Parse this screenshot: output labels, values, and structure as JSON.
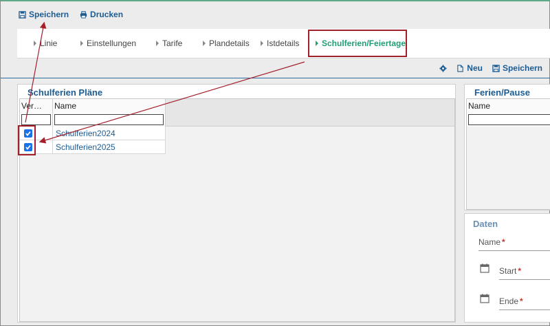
{
  "toolbar": {
    "save_label": "Speichern",
    "print_label": "Drucken"
  },
  "tabs": [
    {
      "label": "Linie",
      "active": false
    },
    {
      "label": "Einstellungen",
      "active": false
    },
    {
      "label": "Tarife",
      "active": false
    },
    {
      "label": "Plandetails",
      "active": false
    },
    {
      "label": "Istdetails",
      "active": false
    },
    {
      "label": "Schulferien/Feiertage",
      "active": true
    }
  ],
  "actions": {
    "settings_icon": "gear-icon",
    "new_label": "Neu",
    "save_label": "Speichern"
  },
  "left_panel": {
    "title": "Schulferien Pläne",
    "columns": [
      "Ver…",
      "Name"
    ],
    "filter_values": [
      "",
      ""
    ],
    "rows": [
      {
        "checked": true,
        "name": "Schulferien2024"
      },
      {
        "checked": true,
        "name": "Schulferien2025"
      }
    ]
  },
  "right_panel": {
    "title": "Ferien/Pause",
    "columns": [
      "Name"
    ],
    "filter_values": [
      ""
    ]
  },
  "daten": {
    "title": "Daten",
    "fields": [
      {
        "label": "Name",
        "required": true
      },
      {
        "label": "Start",
        "required": true
      },
      {
        "label": "Ende",
        "required": true
      }
    ]
  },
  "colors": {
    "accent_blue": "#1c5c93",
    "active_tab": "#1f9e77",
    "annotation_red": "#a3202b",
    "checkbox": "#1a73e8"
  }
}
